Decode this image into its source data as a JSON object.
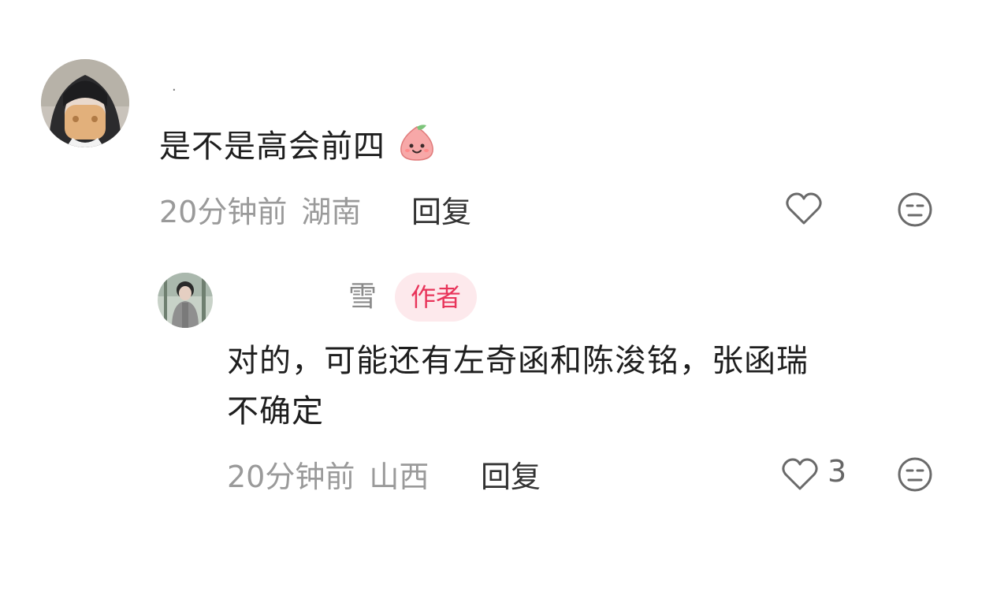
{
  "comments": [
    {
      "username": "·",
      "text": "是不是高会前四",
      "emoji": "peach-smile-emoji",
      "time": "20分钟前",
      "location": "湖南",
      "reply_label": "回复",
      "icons": {
        "like": "heart-outline-icon",
        "dislike": "meh-face-icon"
      }
    }
  ],
  "reply": {
    "username": "雪",
    "badge": "作者",
    "text_line1": "对的，可能还有左奇函和陈浚铭，张函瑞",
    "text_line2": "不确定",
    "time": "20分钟前",
    "location": "山西",
    "reply_label": "回复",
    "like_count": "3",
    "icons": {
      "like": "heart-outline-icon",
      "dislike": "meh-face-icon"
    }
  },
  "colors": {
    "badge_bg": "#fde9ec",
    "badge_text": "#e8345a",
    "meta": "#9a9a9a"
  }
}
